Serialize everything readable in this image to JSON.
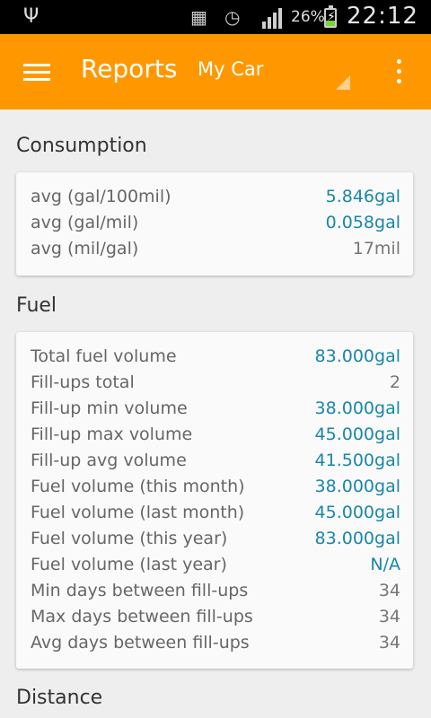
{
  "status_bar": {
    "usb_icon": "usb-icon",
    "battery_percent": "26%",
    "time": "22:12"
  },
  "app_bar": {
    "title": "Reports",
    "car_selector": "My Car"
  },
  "sections": {
    "consumption": {
      "title": "Consumption",
      "rows": [
        {
          "label": "avg (gal/100mil)",
          "value": "5.846gal"
        },
        {
          "label": "avg (gal/mil)",
          "value": "0.058gal"
        },
        {
          "label": "avg (mil/gal)",
          "value": "17mil"
        }
      ]
    },
    "fuel": {
      "title": "Fuel",
      "rows": [
        {
          "label": "Total fuel volume",
          "value": "83.000gal"
        },
        {
          "label": "Fill-ups total",
          "value": "2"
        },
        {
          "label": "Fill-up min volume",
          "value": "38.000gal"
        },
        {
          "label": "Fill-up max volume",
          "value": "45.000gal"
        },
        {
          "label": "Fill-up avg volume",
          "value": "41.500gal"
        },
        {
          "label": "Fuel volume (this month)",
          "value": "38.000gal"
        },
        {
          "label": "Fuel volume (last month)",
          "value": "45.000gal"
        },
        {
          "label": "Fuel volume (this year)",
          "value": "83.000gal"
        },
        {
          "label": "Fuel volume (last year)",
          "value": "N/A"
        },
        {
          "label": "Min days between fill-ups",
          "value": "34"
        },
        {
          "label": "Max days between fill-ups",
          "value": "34"
        },
        {
          "label": "Avg days between fill-ups",
          "value": "34"
        }
      ]
    },
    "distance": {
      "title": "Distance"
    }
  },
  "colors": {
    "app_bar": "#ff9800",
    "value_accent": "#1a86a8",
    "value_plain": "#777777"
  }
}
